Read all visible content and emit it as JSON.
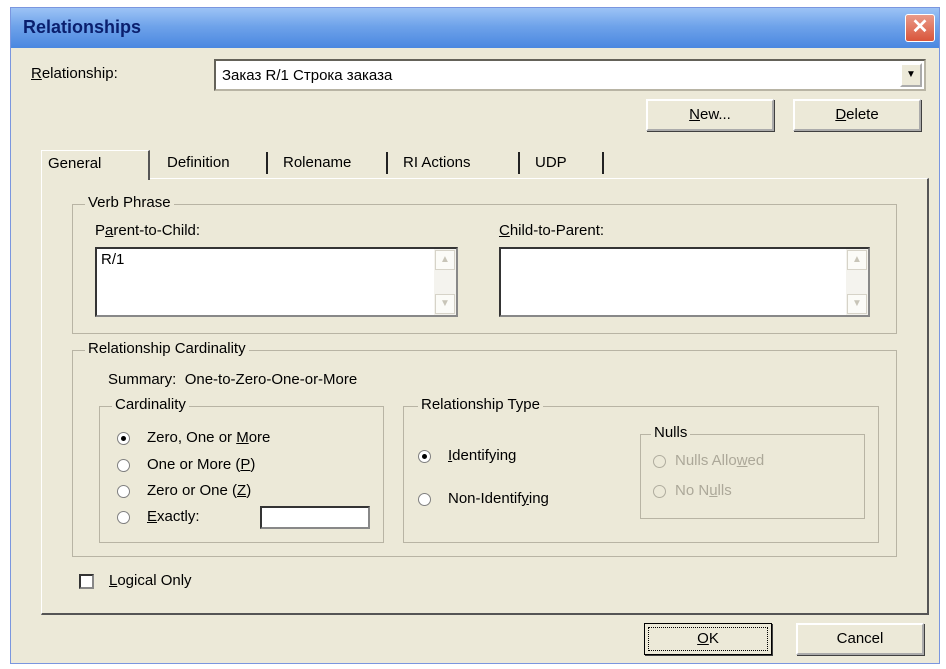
{
  "window": {
    "title": "Relationships",
    "close_glyph": "✕"
  },
  "relationship": {
    "label_pre": "",
    "label_u": "R",
    "label_post": "elationship:",
    "value": "Заказ R/1 Строка заказа"
  },
  "buttons": {
    "new_pre": "",
    "new_u": "N",
    "new_post": "ew...",
    "delete_pre": "",
    "delete_u": "D",
    "delete_post": "elete",
    "ok_pre": "",
    "ok_u": "O",
    "ok_post": "K",
    "cancel": "Cancel"
  },
  "tabs": [
    "General",
    "Definition",
    "Rolename",
    "RI Actions",
    "UDP"
  ],
  "verb_phrase": {
    "legend": "Verb Phrase",
    "p2c_pre": "P",
    "p2c_u": "a",
    "p2c_post": "rent-to-Child:",
    "p2c_value": "R/1",
    "c2p_pre": "",
    "c2p_u": "C",
    "c2p_post": "hild-to-Parent:",
    "c2p_value": ""
  },
  "cardinality_group": {
    "legend": "Relationship Cardinality",
    "summary_label": "Summary:",
    "summary_value": "One-to-Zero-One-or-More"
  },
  "cardinality": {
    "legend": "Cardinality",
    "zero_one_more_pre": "Zero, One or ",
    "zero_one_more_u": "M",
    "zero_one_more_post": "ore",
    "one_or_more_pre": "One or More (",
    "one_or_more_u": "P",
    "one_or_more_post": ")",
    "zero_or_one_pre": "Zero or One (",
    "zero_or_one_u": "Z",
    "zero_or_one_post": ")",
    "exactly_pre": "",
    "exactly_u": "E",
    "exactly_post": "xactly:",
    "exactly_value": "",
    "selected": "zero_one_more"
  },
  "relationship_type": {
    "legend": "Relationship Type",
    "identifying_pre": "",
    "identifying_u": "I",
    "identifying_post": "dentifying",
    "non_identifying_pre": "Non-Identif",
    "non_identifying_u": "y",
    "non_identifying_post": "ing",
    "selected": "identifying"
  },
  "nulls": {
    "legend": "Nulls",
    "allowed_pre": "Nulls Allo",
    "allowed_u": "w",
    "allowed_post": "ed",
    "no_nulls_pre": "No N",
    "no_nulls_u": "u",
    "no_nulls_post": "lls"
  },
  "logical_only": {
    "pre": "",
    "u": "L",
    "post": "ogical Only",
    "checked": false
  }
}
